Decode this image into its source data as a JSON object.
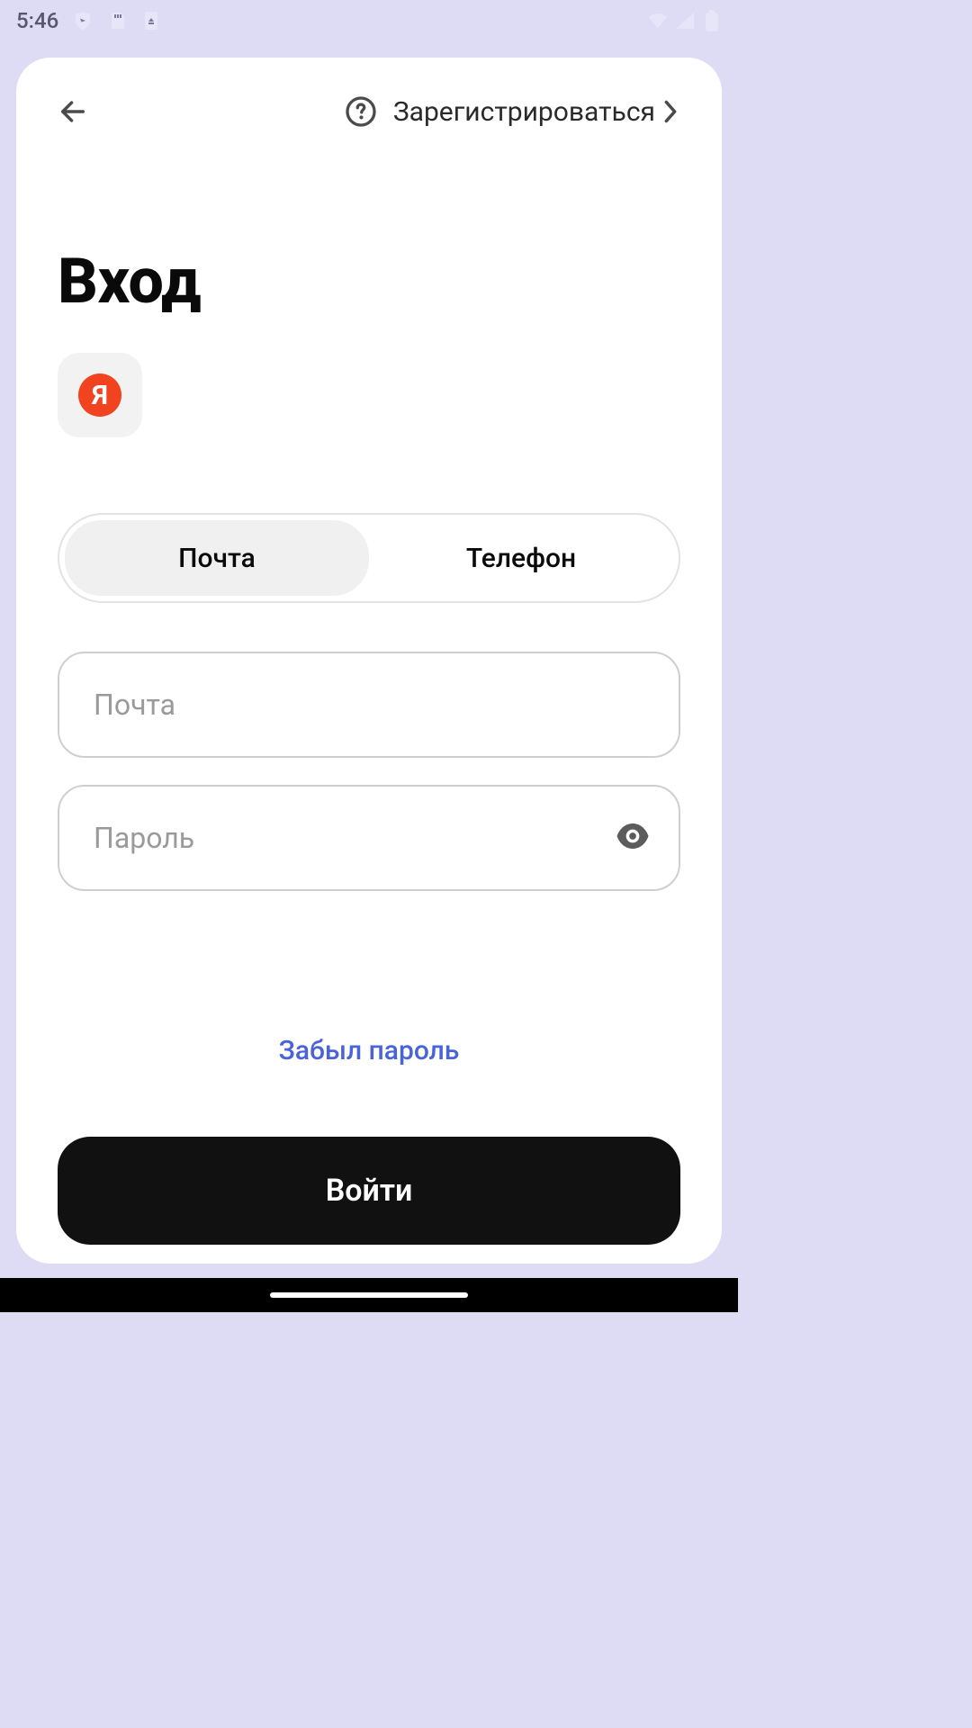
{
  "status": {
    "time": "5:46"
  },
  "topbar": {
    "register_label": "Зарегистрироваться"
  },
  "page": {
    "title": "Вход",
    "badge_glyph": "Я"
  },
  "segments": {
    "email_label": "Почта",
    "phone_label": "Телефон"
  },
  "inputs": {
    "email_placeholder": "Почта",
    "password_placeholder": "Пароль"
  },
  "links": {
    "forgot_label": "Забыл пароль"
  },
  "buttons": {
    "login_label": "Войти"
  }
}
